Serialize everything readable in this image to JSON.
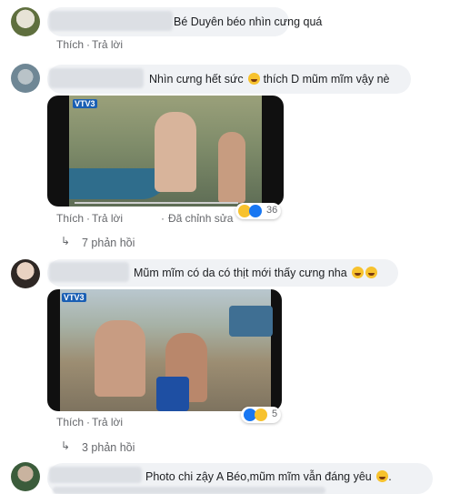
{
  "comments": [
    {
      "text": "Bé Duyên béo nhìn cưng quá",
      "actions": {
        "like": "Thích",
        "reply": "Trả lời"
      }
    },
    {
      "text": "Nhìn cưng hết sức",
      "text2": "thích D mũm mĩm vậy nè",
      "actions": {
        "like": "Thích",
        "reply": "Trả lời",
        "edited": "Đã chỉnh sửa"
      },
      "reaction_count": "36",
      "replies": "7 phản hồi",
      "media_badge": "VTV3"
    },
    {
      "text": "Mũm mĩm có da có thịt mới thấy cưng nha",
      "actions": {
        "like": "Thích",
        "reply": "Trả lời"
      },
      "reaction_count": "5",
      "replies": "3 phản hồi",
      "media_badge": "VTV3"
    },
    {
      "text": "Photo chi zậy A Béo,mũm mĩm vẫn đáng yêu"
    }
  ],
  "colors": {
    "bubble": "#f0f2f5",
    "meta": "#65676b",
    "like": "#1877f2",
    "haha": "#f7c22e"
  }
}
